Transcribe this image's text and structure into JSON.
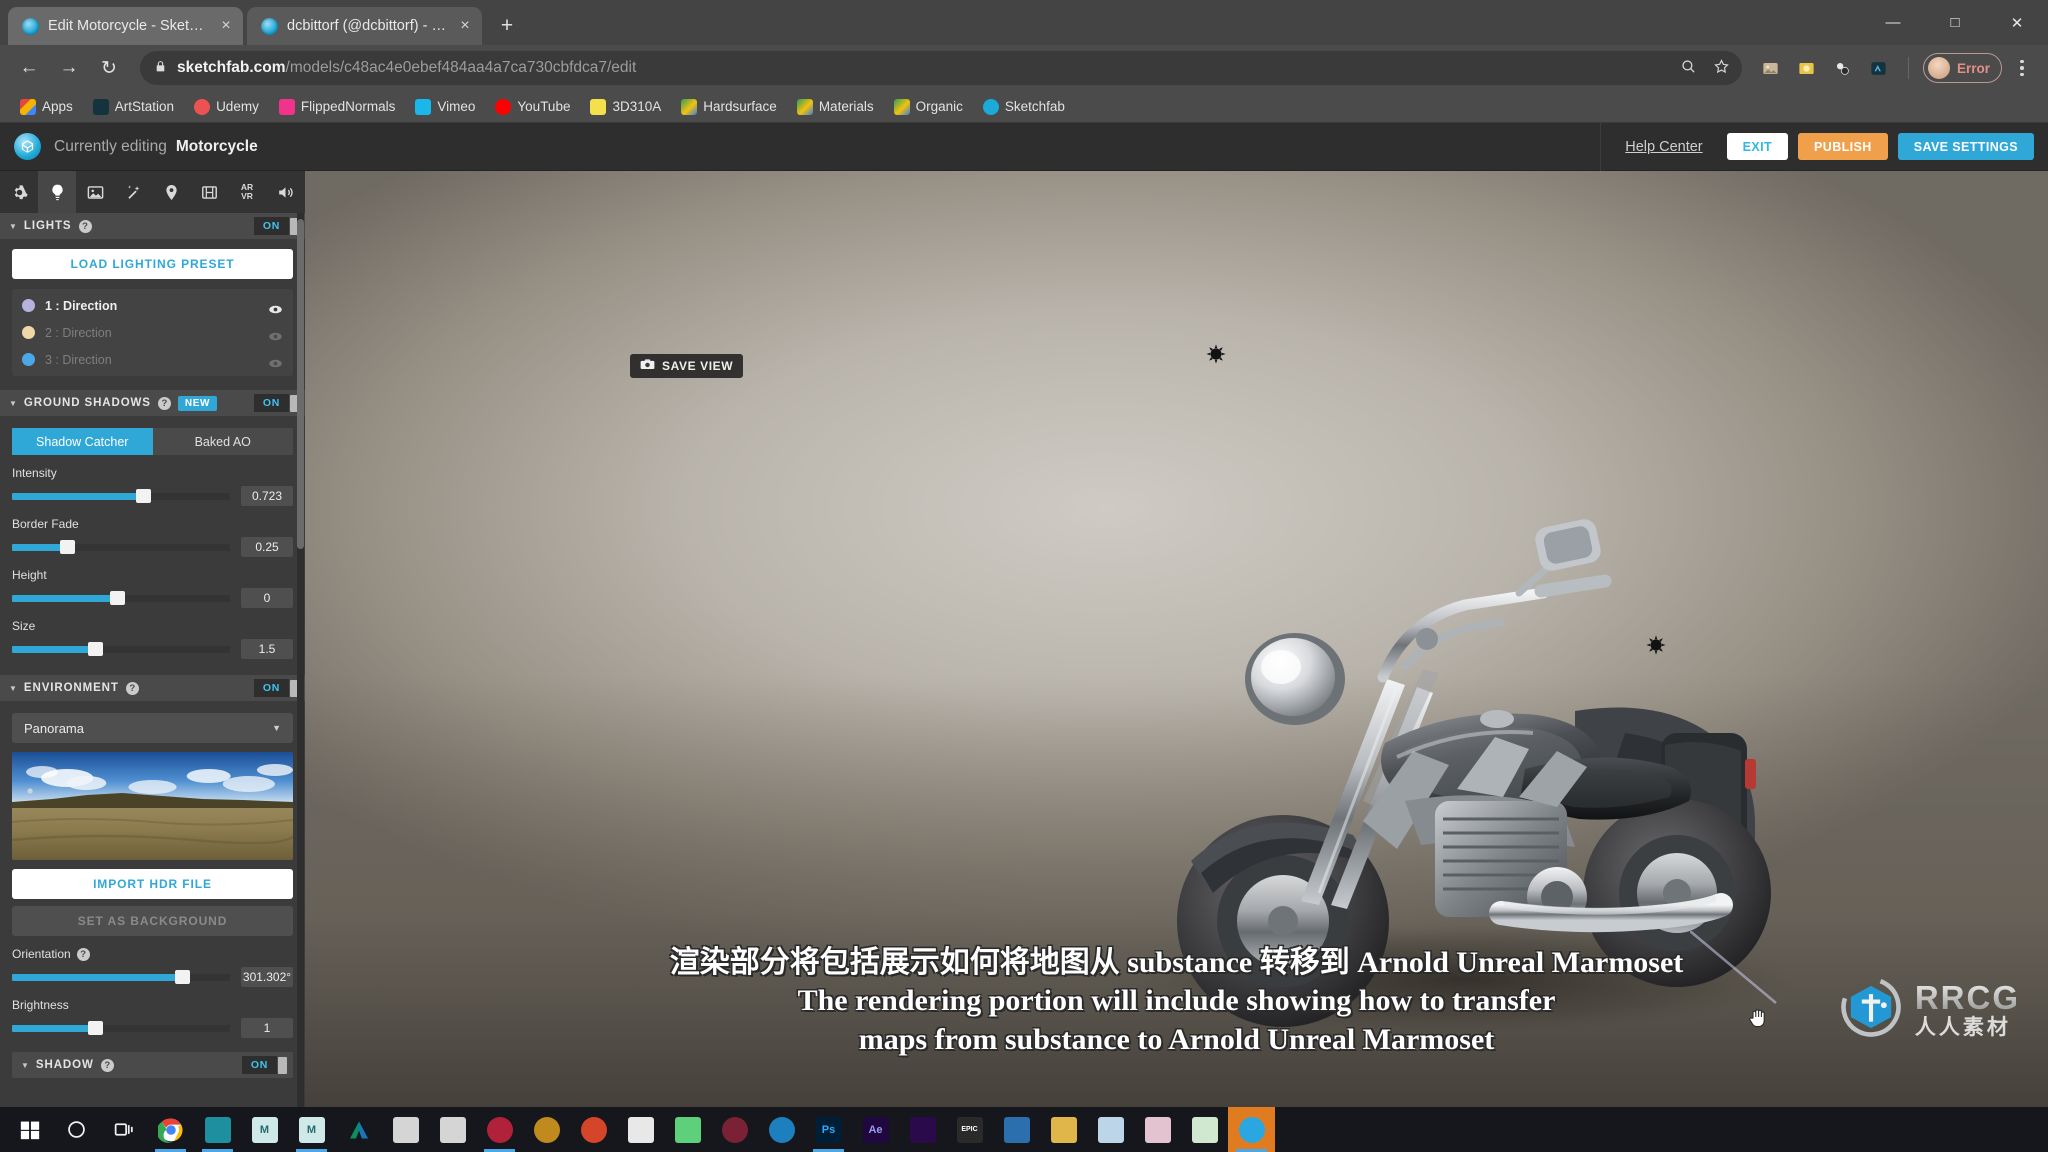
{
  "browser": {
    "tabs": [
      {
        "title": "Edit Motorcycle - Sketchfab",
        "close": "×",
        "active": true
      },
      {
        "title": "dcbittorf (@dcbittorf) - Sketchfab",
        "close": "×",
        "active": false
      }
    ],
    "new_tab_label": "+",
    "window_controls": {
      "minimize": "—",
      "maximize": "□",
      "close": "✕"
    },
    "nav": {
      "back": "←",
      "forward": "→",
      "reload": "↻"
    },
    "url": {
      "lock": "🔒",
      "domain": "sketchfab.com",
      "path": "/models/c48ac4e0ebef484aa4a7ca730cbfdca7/edit"
    },
    "url_icons": {
      "search": "search-icon",
      "bookmark": "star-icon"
    },
    "profile": {
      "error_label": "Error"
    },
    "bookmarks": [
      {
        "label": "Apps",
        "color": "#e8b33a"
      },
      {
        "label": "ArtStation",
        "color": "#14333e"
      },
      {
        "label": "Udemy",
        "color": "#a435f0"
      },
      {
        "label": "FlippedNormals",
        "color": "#f2338c"
      },
      {
        "label": "Vimeo",
        "color": "#1ab7ea"
      },
      {
        "label": "YouTube",
        "color": "#ff0000"
      },
      {
        "label": "3D310A",
        "color": "#f4e04d"
      },
      {
        "label": "Hardsurface",
        "color": "#2e9e5b"
      },
      {
        "label": "Materials",
        "color": "#2e9e5b"
      },
      {
        "label": "Organic",
        "color": "#2e9e5b"
      },
      {
        "label": "Sketchfab",
        "color": "#1caad9"
      }
    ]
  },
  "sketchfab": {
    "header": {
      "editing_prefix": "Currently editing",
      "model_name": "Motorcycle",
      "help_center": "Help Center",
      "exit": "EXIT",
      "publish": "PUBLISH",
      "save_settings": "SAVE SETTINGS"
    },
    "toolbar": [
      {
        "name": "gear-icon",
        "selected": false
      },
      {
        "name": "light-bulb-icon",
        "selected": true
      },
      {
        "name": "image-icon",
        "selected": false
      },
      {
        "name": "magic-wand-icon",
        "selected": false
      },
      {
        "name": "map-pin-icon",
        "selected": false
      },
      {
        "name": "film-icon",
        "selected": false
      },
      {
        "name": "ar-vr-icon",
        "selected": false,
        "text_top": "AR",
        "text_bottom": "VR"
      },
      {
        "name": "sound-icon",
        "selected": false
      }
    ],
    "lights": {
      "section_title": "LIGHTS",
      "toggle_state": "ON",
      "load_preset": "LOAD LIGHTING PRESET",
      "items": [
        {
          "label": "1 : Direction",
          "color": "#b5b3dd",
          "enabled": true
        },
        {
          "label": "2 : Direction",
          "color": "#f0d7a8",
          "enabled": false
        },
        {
          "label": "3 : Direction",
          "color": "#4aa8e8",
          "enabled": false
        }
      ]
    },
    "ground_shadows": {
      "section_title": "GROUND SHADOWS",
      "badge": "NEW",
      "toggle_state": "ON",
      "tabs": [
        {
          "label": "Shadow Catcher",
          "active": true
        },
        {
          "label": "Baked AO",
          "active": false
        }
      ],
      "sliders": [
        {
          "label": "Intensity",
          "value": "0.723",
          "pct": 60
        },
        {
          "label": "Border Fade",
          "value": "0.25",
          "pct": 25
        },
        {
          "label": "Height",
          "value": "0",
          "pct": 48
        },
        {
          "label": "Size",
          "value": "1.5",
          "pct": 38
        }
      ]
    },
    "environment": {
      "section_title": "ENVIRONMENT",
      "toggle_state": "ON",
      "select_value": "Panorama",
      "import_hdr": "IMPORT HDR FILE",
      "set_background": "SET AS BACKGROUND",
      "sliders": [
        {
          "label": "Orientation",
          "value": "301.302°",
          "pct": 78,
          "has_help": true
        },
        {
          "label": "Brightness",
          "value": "1",
          "pct": 38,
          "has_help": false
        }
      ]
    },
    "shadow": {
      "section_title": "SHADOW",
      "toggle_state": "ON"
    },
    "viewport": {
      "save_view": "SAVE VIEW",
      "save_view_icon": "camera-icon",
      "cursor": "grab-hand-cursor",
      "gizmos": [
        "light-gizmo-1",
        "light-gizmo-2"
      ]
    }
  },
  "subtitles": {
    "line1": "渲染部分将包括展示如何将地图从 substance 转移到 Arnold Unreal Marmoset",
    "line2": "The rendering portion will include showing how to transfer",
    "line3": "maps from substance to Arnold Unreal Marmoset"
  },
  "watermark": {
    "brand": "RRCG",
    "cn": "人人素材"
  },
  "taskbar": {
    "start": "start-icon",
    "search": "search-circle-icon",
    "taskview": "task-view-icon",
    "apps": [
      {
        "name": "chrome",
        "label": "",
        "color": "#ffffff",
        "active": true
      },
      {
        "name": "zbrush",
        "label": "",
        "color": "#1d8f9e",
        "active": true
      },
      {
        "name": "marmoset-1",
        "label": "M",
        "color": "#cfe8e8",
        "active": false
      },
      {
        "name": "marmoset-2",
        "label": "M",
        "color": "#cfe8e8",
        "active": true
      },
      {
        "name": "autodesk",
        "label": "",
        "color": "#0a8f5f",
        "active": false
      },
      {
        "name": "maya-1",
        "label": "",
        "color": "#d5d5d5",
        "active": false
      },
      {
        "name": "maya-2",
        "label": "",
        "color": "#d5d5d5",
        "active": false
      },
      {
        "name": "substance-painter",
        "label": "",
        "color": "#b2213a",
        "active": true
      },
      {
        "name": "substance-designer",
        "label": "",
        "color": "#c08a1e",
        "active": false
      },
      {
        "name": "substance-alchemist",
        "label": "",
        "color": "#d4452a",
        "active": false
      },
      {
        "name": "explorer",
        "label": "",
        "color": "#e8b33a",
        "active": false
      },
      {
        "name": "quixel",
        "label": "",
        "color": "#f0f0f0",
        "active": false
      },
      {
        "name": "unity",
        "label": "",
        "color": "#8cc63f",
        "active": false
      },
      {
        "name": "blender",
        "label": "",
        "color": "#e87d0d",
        "active": false
      },
      {
        "name": "keyshot",
        "label": "",
        "color": "#2aa7e0",
        "active": false
      },
      {
        "name": "photoshop",
        "label": "Ps",
        "color": "#001e36",
        "active": true
      },
      {
        "name": "after-effects",
        "label": "Ae",
        "color": "#1f0740",
        "active": false
      },
      {
        "name": "premiere",
        "label": "",
        "color": "#2a0a4a",
        "active": false
      },
      {
        "name": "epic-games",
        "label": "EPIC",
        "color": "#2a2a2a",
        "active": false
      },
      {
        "name": "unreal",
        "label": "",
        "color": "#1b4a7a",
        "active": false
      },
      {
        "name": "folder",
        "label": "",
        "color": "#e0b64a",
        "active": false
      },
      {
        "name": "notes",
        "label": "",
        "color": "#bcd5e8",
        "active": false
      },
      {
        "name": "painter-alt",
        "label": "",
        "color": "#e3c3cf",
        "active": false
      },
      {
        "name": "designer-alt",
        "label": "",
        "color": "#cfe8cf",
        "active": false
      },
      {
        "name": "telegram",
        "label": "",
        "color": "#2aa7e0",
        "active": true,
        "highlight": true
      }
    ]
  }
}
